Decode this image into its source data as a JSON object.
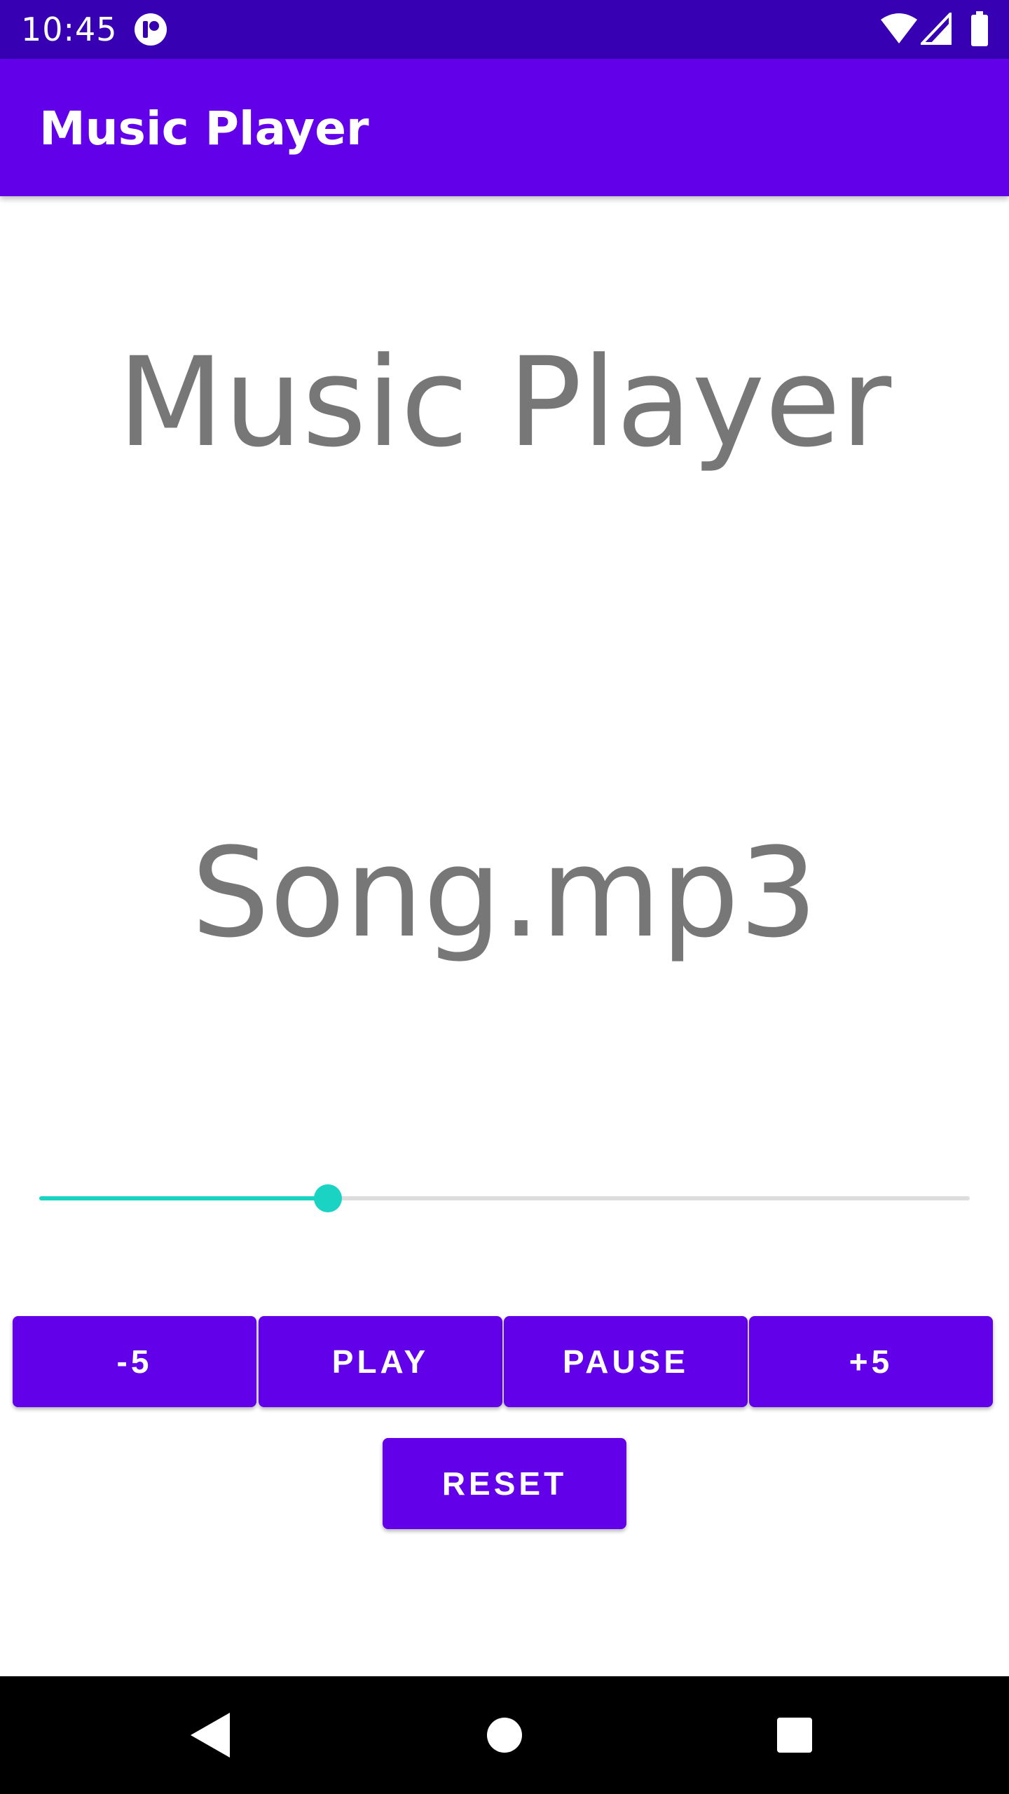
{
  "status_bar": {
    "time": "10:45",
    "icons": [
      "app-notification-icon",
      "wifi-icon",
      "cellular-signal-icon",
      "battery-icon"
    ]
  },
  "app_bar": {
    "title": "Music Player"
  },
  "main": {
    "heading": "Music Player",
    "song_title": "Song.mp3",
    "seekbar": {
      "progress_fraction": 0.31
    }
  },
  "controls": {
    "rewind_label": "-5",
    "play_label": "PLAY",
    "pause_label": "PAUSE",
    "forward_label": "+5",
    "reset_label": "RESET"
  },
  "nav_bar": {
    "icons": [
      "back-icon",
      "home-icon",
      "recents-icon"
    ]
  },
  "colors": {
    "status_bar": "#3700b3",
    "primary": "#6200ea",
    "accent": "#1ad3c2",
    "text_gray": "#777777"
  }
}
